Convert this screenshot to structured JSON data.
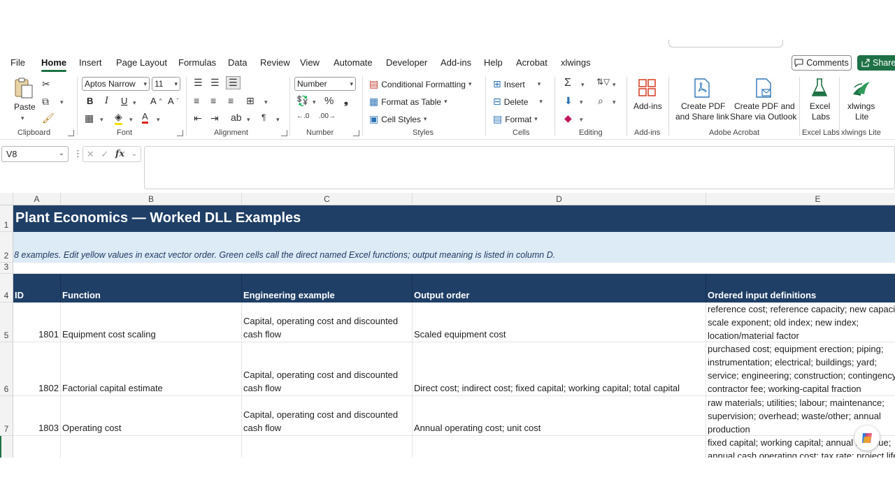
{
  "menu": {
    "tabs": [
      "File",
      "Home",
      "Insert",
      "Page Layout",
      "Formulas",
      "Data",
      "Review",
      "View",
      "Automate",
      "Developer",
      "Add-ins",
      "Help",
      "Acrobat",
      "xlwings"
    ],
    "active": "Home",
    "comments_label": "Comments",
    "share_label": "Share"
  },
  "ribbon": {
    "clipboard": {
      "label": "Clipboard",
      "paste": "Paste"
    },
    "font": {
      "label": "Font",
      "font_name": "Aptos Narrow",
      "font_size": "11",
      "bold": "B",
      "italic": "I",
      "underline": "U"
    },
    "alignment": {
      "label": "Alignment"
    },
    "number": {
      "label": "Number",
      "format": "Number"
    },
    "styles": {
      "label": "Styles",
      "conditional": "Conditional Formatting",
      "format_table": "Format as Table",
      "cell_styles": "Cell Styles"
    },
    "cells": {
      "label": "Cells",
      "insert": "Insert",
      "delete": "Delete",
      "format": "Format"
    },
    "editing": {
      "label": "Editing"
    },
    "addins": {
      "label": "Add-ins",
      "button": "Add-ins"
    },
    "acrobat": {
      "label": "Adobe Acrobat",
      "pdf_link_1": "Create PDF",
      "pdf_link_2": "and Share link",
      "pdf_outlook_1": "Create PDF and",
      "pdf_outlook_2": "Share via Outlook"
    },
    "excel_labs": {
      "label": "Excel Labs",
      "btn_1": "Excel",
      "btn_2": "Labs"
    },
    "xlwings": {
      "label": "xlwings Lite",
      "btn_1": "xlwings",
      "btn_2": "Lite"
    }
  },
  "formula_bar": {
    "name_box": "V8",
    "fx": "fx",
    "formula": ""
  },
  "columns": [
    "A",
    "B",
    "C",
    "D",
    "E"
  ],
  "rows": [
    "1",
    "2",
    "3",
    "4",
    "5",
    "6",
    "7"
  ],
  "sheet": {
    "title": "Plant Economics — Worked DLL Examples",
    "subtitle": "8 examples. Edit yellow values in exact vector order. Green cells call the direct named Excel functions; output meaning is listed in column D.",
    "headers": [
      "ID",
      "Function",
      "Engineering example",
      "Output order",
      "Ordered input definitions"
    ],
    "data_rows": [
      {
        "id": "1801",
        "function": "Equipment cost scaling",
        "example": "Capital, operating cost and discounted cash flow",
        "output": "Scaled equipment cost",
        "inputs": "reference cost; reference capacity; new capacity; scale exponent; old index; new index; location/material factor"
      },
      {
        "id": "1802",
        "function": "Factorial capital estimate",
        "example": "Capital, operating cost and discounted cash flow",
        "output": "Direct cost; indirect cost; fixed capital; working capital; total capital",
        "inputs": "purchased cost; equipment erection; piping; instrumentation; electrical; buildings; yard; service; engineering; construction; contingency; contractor fee; working-capital fraction"
      },
      {
        "id": "1803",
        "function": "Operating cost",
        "example": "Capital, operating cost and discounted cash flow",
        "output": "Annual operating cost; unit cost",
        "inputs": "raw materials; utilities; labour; maintenance; supervision; overhead; waste/other; annual production"
      },
      {
        "id": "",
        "function": "",
        "example": "",
        "output": "",
        "inputs": "fixed capital; working capital; annual revenue; annual cash operating cost; tax rate; project life"
      }
    ]
  }
}
